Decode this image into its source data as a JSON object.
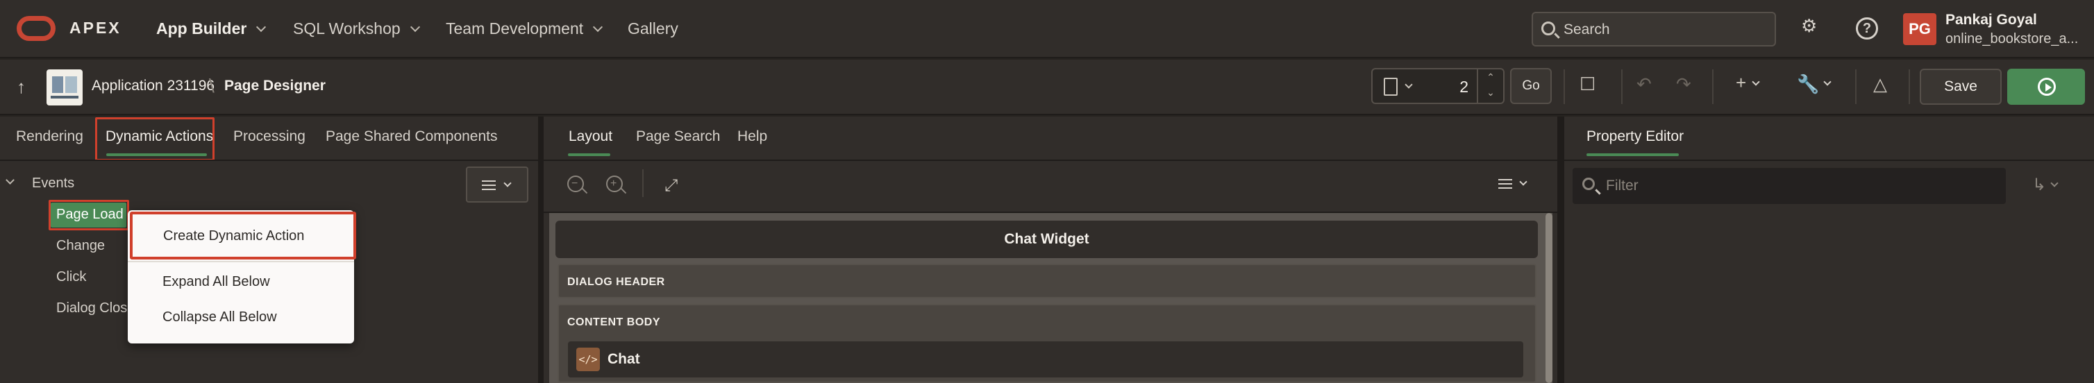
{
  "topnav": {
    "brand": "APEX",
    "items": [
      {
        "label": "App Builder",
        "has_menu": true
      },
      {
        "label": "SQL Workshop",
        "has_menu": true
      },
      {
        "label": "Team Development",
        "has_menu": true
      },
      {
        "label": "Gallery",
        "has_menu": false
      }
    ],
    "search_placeholder": "Search",
    "user": {
      "initials": "PG",
      "name": "Pankaj Goyal",
      "workspace": "online_bookstore_a..."
    }
  },
  "toolbar": {
    "application": "Application 231196",
    "separator": "\\",
    "page_designer": "Page Designer",
    "page_number": "2",
    "go_label": "Go",
    "save_label": "Save"
  },
  "left_panel": {
    "tabs": [
      {
        "label": "Rendering"
      },
      {
        "label": "Dynamic Actions",
        "active": true
      },
      {
        "label": "Processing"
      },
      {
        "label": "Page Shared Components"
      }
    ],
    "tree": {
      "root": "Events",
      "items": [
        "Page Load",
        "Change",
        "Click",
        "Dialog Closed"
      ],
      "selected": "Page Load"
    },
    "context_menu": [
      "Create Dynamic Action",
      "Expand All Below",
      "Collapse All Below"
    ]
  },
  "mid_panel": {
    "tabs": [
      {
        "label": "Layout",
        "active": true
      },
      {
        "label": "Page Search"
      },
      {
        "label": "Help"
      }
    ],
    "widget_title": "Chat Widget",
    "regions": [
      "DIALOG HEADER",
      "CONTENT BODY"
    ],
    "chat_item": "Chat",
    "code_icon": "</>"
  },
  "right_panel": {
    "tab": "Property Editor",
    "filter_placeholder": "Filter"
  },
  "colors": {
    "accent_green": "#4a8a55",
    "oracle_red": "#c74634",
    "highlight_red": "#d0402c"
  }
}
